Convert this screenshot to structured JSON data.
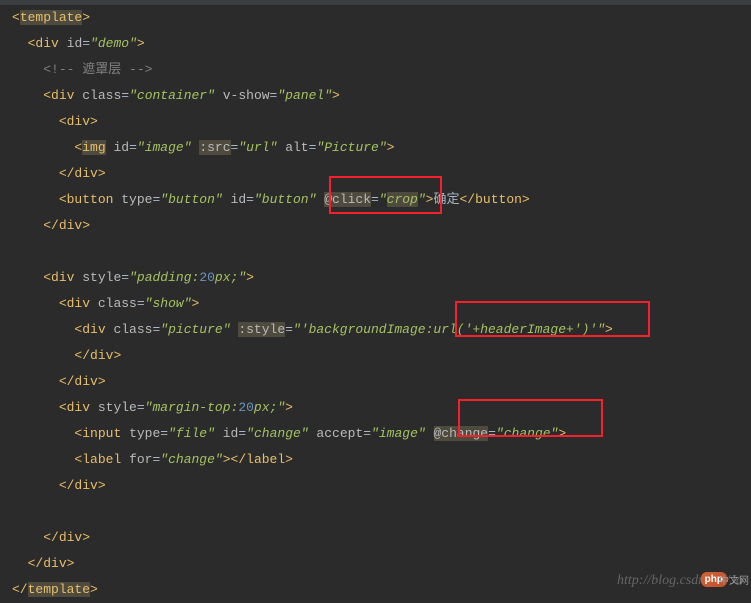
{
  "lines": {
    "l1": {
      "tag_open": "<",
      "tagname": "template",
      "tag_close": ">"
    },
    "l2": {
      "open": "<",
      "tag": "div",
      "a1": "id",
      "v1": "demo",
      "close": ">"
    },
    "l3": {
      "comment": "<!-- 遮罩层 -->"
    },
    "l4": {
      "open": "<",
      "tag": "div",
      "a1": "class",
      "v1": "container",
      "a2": "v-show",
      "v2": "panel",
      "close": ">"
    },
    "l5": {
      "open": "<",
      "tag": "div",
      "close": ">"
    },
    "l6": {
      "open": "<",
      "tag": "img",
      "a1": "id",
      "v1": "image",
      "a2": ":src",
      "v2": "url",
      "a3": "alt",
      "v3": "Picture",
      "close": ">"
    },
    "l7": {
      "open": "</",
      "tag": "div",
      "close": ">"
    },
    "l8": {
      "open": "<",
      "tag": "button",
      "a1": "type",
      "v1": "button",
      "a2": "id",
      "v2": "button",
      "a3": "@click",
      "v3": "crop",
      "close": ">",
      "text": "确定",
      "open2": "</",
      "tag2": "button",
      "close2": ">"
    },
    "l9": {
      "open": "</",
      "tag": "div",
      "close": ">"
    },
    "l11": {
      "open": "<",
      "tag": "div",
      "a1": "style",
      "v1a": "padding:",
      "v1b": "20",
      "v1c": "px;",
      "close": ">"
    },
    "l12": {
      "open": "<",
      "tag": "div",
      "a1": "class",
      "v1": "show",
      "close": ">"
    },
    "l13": {
      "open": "<",
      "tag": "div",
      "a1": "class",
      "v1": "picture",
      "a2": ":style",
      "v2": "'backgroundImage:url('+headerImage+')'",
      "close": ">"
    },
    "l14": {
      "open": "</",
      "tag": "div",
      "close": ">"
    },
    "l15": {
      "open": "</",
      "tag": "div",
      "close": ">"
    },
    "l16": {
      "open": "<",
      "tag": "div",
      "a1": "style",
      "v1a": "margin-top:",
      "v1b": "20",
      "v1c": "px;",
      "close": ">"
    },
    "l17": {
      "open": "<",
      "tag": "input",
      "a1": "type",
      "v1": "file",
      "a2": "id",
      "v2": "change",
      "a3": "accept",
      "v3": "image",
      "a4": "@change",
      "v4": "change",
      "close": ">"
    },
    "l18": {
      "open": "<",
      "tag": "label",
      "a1": "for",
      "v1": "change",
      "close": ">",
      "open2": "</",
      "tag2": "label",
      "close2": ">"
    },
    "l19": {
      "open": "</",
      "tag": "div",
      "close": ">"
    },
    "l21": {
      "open": "</",
      "tag": "div",
      "close": ">"
    },
    "l22": {
      "open": "</",
      "tag": "div",
      "close": ">"
    },
    "l23": {
      "open": "</",
      "tagname": "template",
      "close": ">"
    }
  },
  "watermark": "http://blog.csdn.net/Ja",
  "badge_php": "php",
  "badge_cn": "中文网"
}
